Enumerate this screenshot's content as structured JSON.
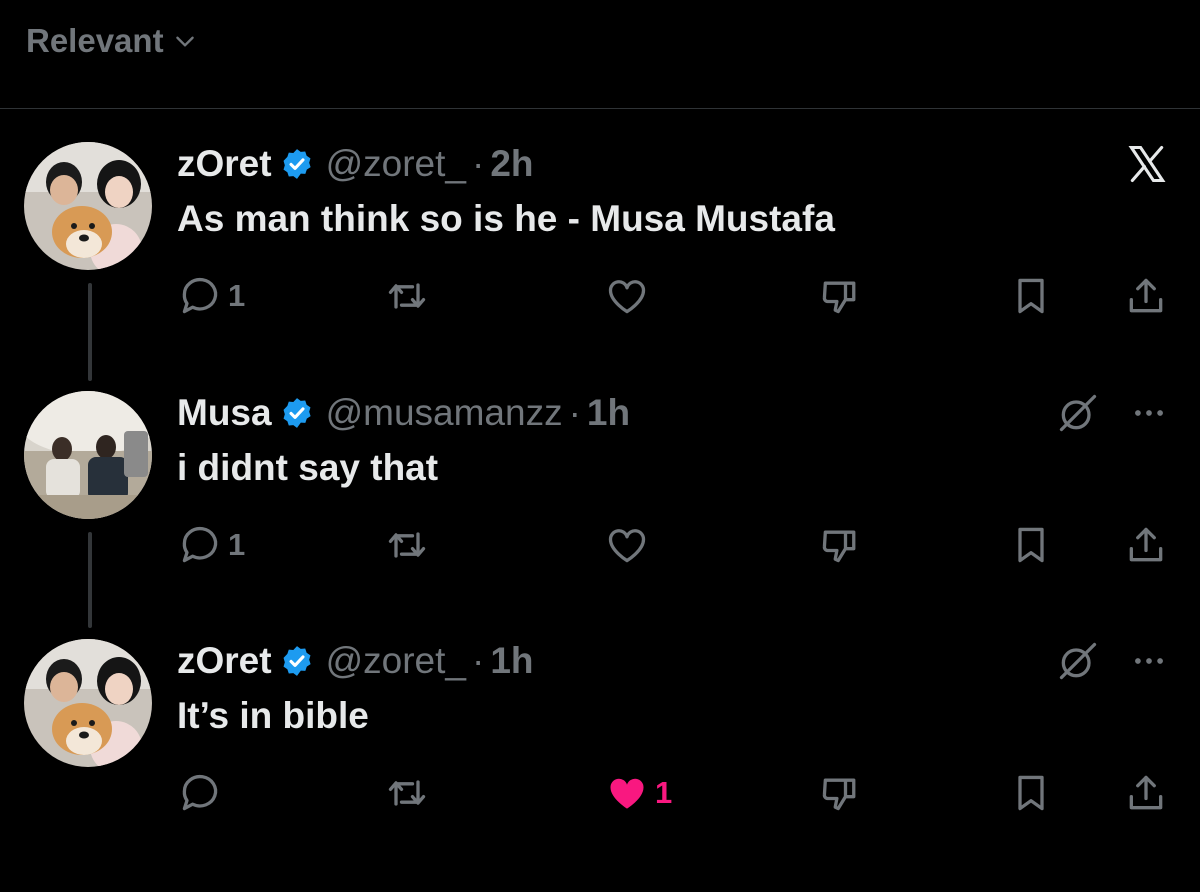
{
  "sort": {
    "label": "Relevant",
    "icon": "chevron-down-icon"
  },
  "colors": {
    "background": "#000000",
    "text": "#e7e9ea",
    "muted": "#71767b",
    "verified": "#1d9bf0",
    "like": "#f91880"
  },
  "posts": [
    {
      "name": "zOret",
      "handle": "@zoret_",
      "dot": "·",
      "time": "2h",
      "text": "As man think so is he - Musa Mustafa",
      "corner": "x-logo-icon",
      "reply_count": "1",
      "like_count": "",
      "liked": false
    },
    {
      "name": "Musa",
      "handle": "@musamanzz",
      "dot": "·",
      "time": "1h",
      "text": "i didnt say that",
      "corner": "grok-icon",
      "reply_count": "1",
      "like_count": "",
      "liked": false
    },
    {
      "name": "zOret",
      "handle": "@zoret_",
      "dot": "·",
      "time": "1h",
      "text": "It’s in bible",
      "corner": "grok-icon",
      "reply_count": "",
      "like_count": "1",
      "liked": true
    }
  ]
}
